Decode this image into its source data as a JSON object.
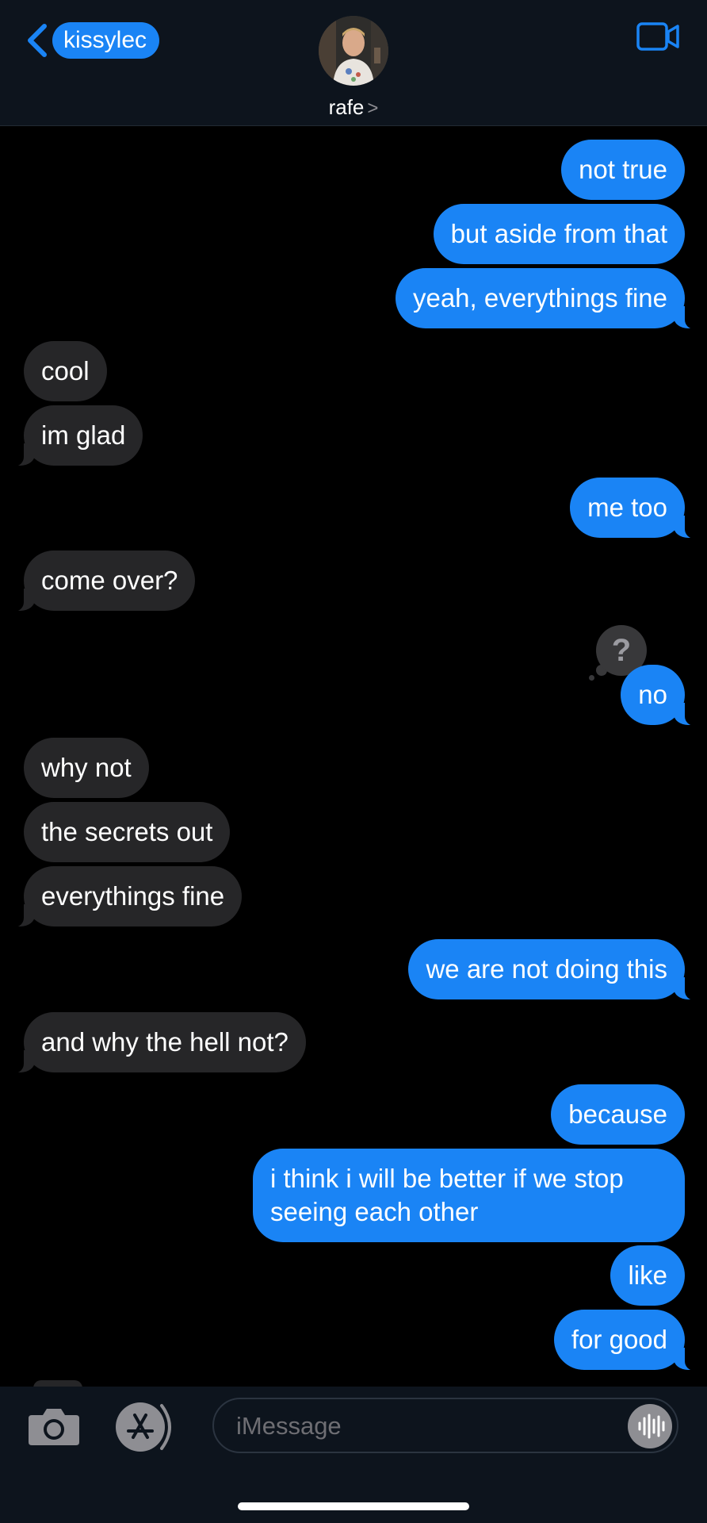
{
  "header": {
    "back_label": "kissylec",
    "contact_name": "rafe",
    "chevron_glyph": ">"
  },
  "messages": [
    {
      "from": "me",
      "text": "not true"
    },
    {
      "from": "me",
      "text": "but aside from that"
    },
    {
      "from": "me",
      "text": "yeah, everythings fine"
    },
    {
      "from": "them",
      "text": "cool"
    },
    {
      "from": "them",
      "text": "im glad"
    },
    {
      "from": "me",
      "text": "me too"
    },
    {
      "from": "them",
      "text": "come over?"
    },
    {
      "from": "me",
      "text": "no",
      "tapback": "?"
    },
    {
      "from": "them",
      "text": "why not"
    },
    {
      "from": "them",
      "text": "the secrets out"
    },
    {
      "from": "them",
      "text": "everythings fine"
    },
    {
      "from": "me",
      "text": "we are not doing this"
    },
    {
      "from": "them",
      "text": "and why the hell not?"
    },
    {
      "from": "me",
      "text": "because"
    },
    {
      "from": "me",
      "text": "i think i will be better if we stop seeing each other"
    },
    {
      "from": "me",
      "text": "like"
    },
    {
      "from": "me",
      "text": "for good"
    }
  ],
  "composer": {
    "placeholder": "iMessage"
  },
  "colors": {
    "outgoing": "#1a84f5",
    "incoming": "#262628",
    "bar": "#0d141d"
  }
}
